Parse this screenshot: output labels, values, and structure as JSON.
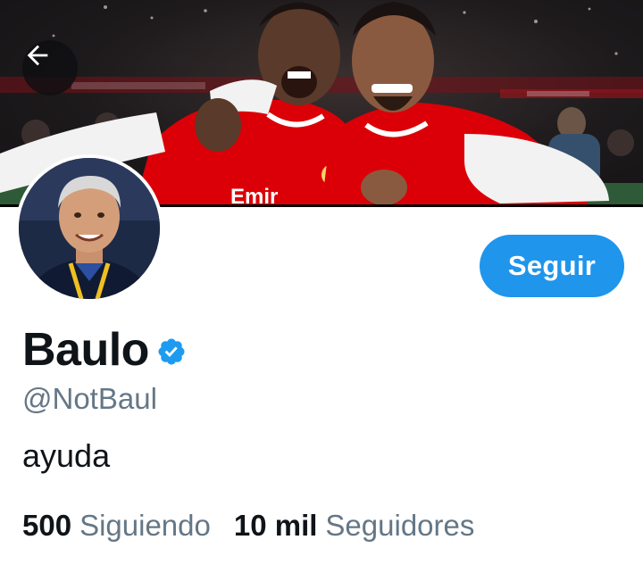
{
  "profile": {
    "display_name": "Baulo",
    "handle": "@NotBaul",
    "bio": "ayuda",
    "verified": true
  },
  "actions": {
    "follow_label": "Seguir",
    "back_icon": "arrow-left-icon"
  },
  "stats": {
    "following_count": "500",
    "following_label": "Siguiendo",
    "followers_count": "10 mil",
    "followers_label": "Seguidores"
  },
  "colors": {
    "accent": "#1f95ec",
    "verified_badge": "#1d9bf0",
    "text_primary": "#0f1419",
    "text_secondary": "#657786",
    "kit_red": "#db0007"
  }
}
